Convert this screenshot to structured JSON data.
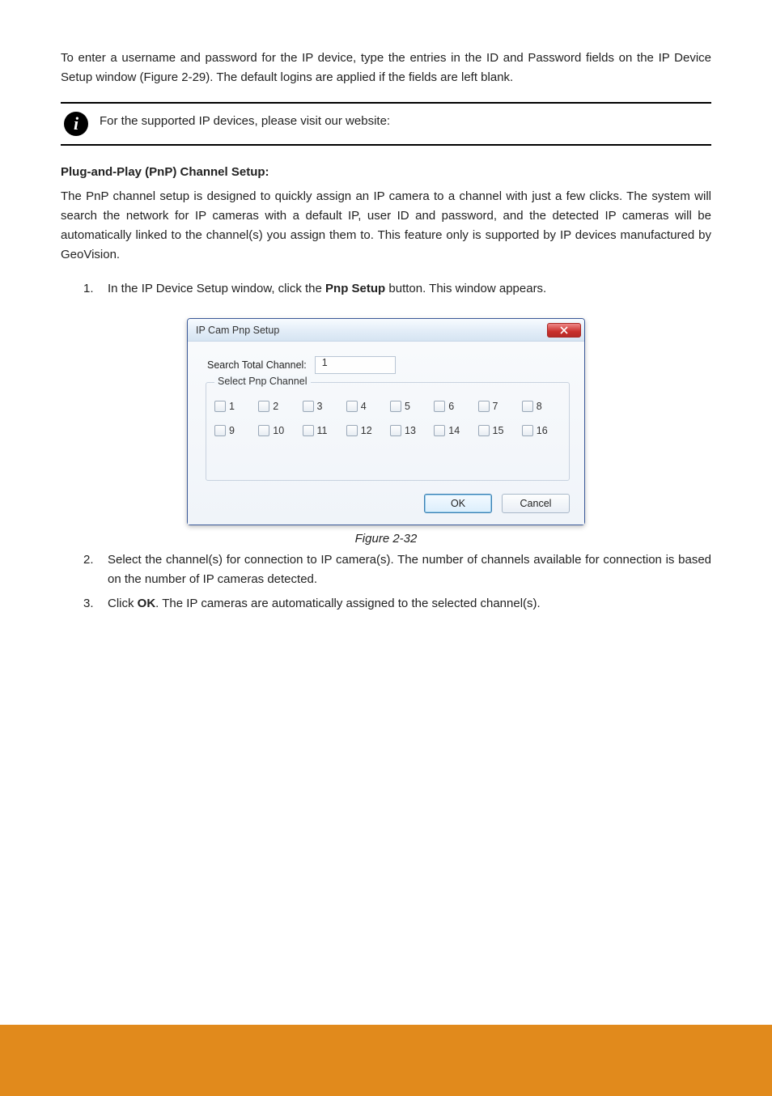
{
  "para1": "To enter a username and password for the IP device, type the entries in the ID and Password fields on the IP Device Setup window (Figure 2-29). The default logins are applied if the fields are left blank.",
  "info": "For the supported IP devices, please visit our website:",
  "heading_pnp": "Plug-and-Play (PnP) Channel Setup:",
  "para2": "The PnP channel setup is designed to quickly assign an IP camera to a channel with just a few clicks. The system will search the network for IP cameras with a default IP, user ID and password, and the detected IP cameras will be automatically linked to the channel(s) you assign them to. This feature only is supported by IP devices manufactured by GeoVision.",
  "list": [
    {
      "n": "1.",
      "body_pre": "In the IP Device Setup window, click the ",
      "bold": "Pnp Setup",
      "body_post": " button. This window appears."
    },
    {
      "n": "2.",
      "body": "Select the channel(s) for connection to IP camera(s). The number of channels available for connection is based on the number of IP cameras detected."
    },
    {
      "n": "3.",
      "body_pre": "Click ",
      "bold": "OK",
      "body_post": ". The IP cameras are automatically assigned to the selected channel(s)."
    }
  ],
  "dialog": {
    "title": "IP Cam Pnp Setup",
    "search_label": "Search Total Channel:",
    "search_value": "1",
    "group_label": "Select Pnp Channel",
    "channels_row1": [
      "1",
      "2",
      "3",
      "4",
      "5",
      "6",
      "7",
      "8"
    ],
    "channels_row2": [
      "9",
      "10",
      "11",
      "12",
      "13",
      "14",
      "15",
      "16"
    ],
    "ok": "OK",
    "cancel": "Cancel"
  },
  "caption": "Figure 2-32"
}
